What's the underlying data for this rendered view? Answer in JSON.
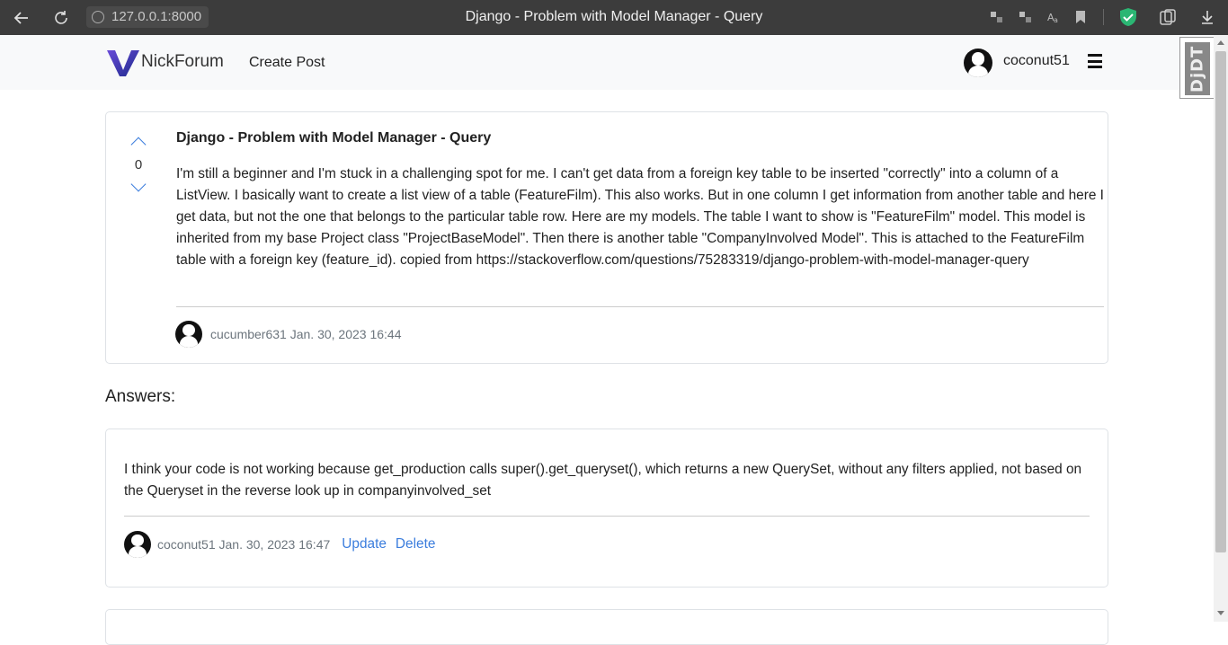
{
  "browser": {
    "url": "127.0.0.1:8000",
    "tab_title": "Django - Problem with Model Manager - Query"
  },
  "navbar": {
    "brand": "NickForum",
    "create_post": "Create Post",
    "username": "coconut51",
    "debug_toolbar": "DjDT"
  },
  "question": {
    "title": "Django - Problem with Model Manager - Query",
    "votes": "0",
    "body": "I'm still a beginner and I'm stuck in a challenging spot for me. I can't get data from a foreign key table to be inserted \"correctly\" into a column of a ListView. I basically want to create a list view of a table (FeatureFilm). This also works. But in one column I get information from another table and here I get data, but not the one that belongs to the particular table row. Here are my models. The table I want to show is \"FeatureFilm\" model. This model is inherited from my base Project class \"ProjectBaseModel\". Then there is another table \"CompanyInvolved Model\". This is attached to the FeatureFilm table with a foreign key (feature_id). copied from https://stackoverflow.com/questions/75283319/django-problem-with-model-manager-query",
    "author": "cucumber631",
    "date": "Jan. 30, 2023 16:44"
  },
  "answers_heading": "Answers:",
  "answers": [
    {
      "body": "I think your code is not working because get_production calls super().get_queryset(), which returns a new QuerySet, without any filters applied, not based on the Queryset in the reverse look up in companyinvolved_set",
      "author": "coconut51",
      "date": "Jan. 30, 2023 16:47",
      "update_label": "Update",
      "delete_label": "Delete"
    }
  ],
  "colors": {
    "link": "#3b7ddd",
    "navbar_bg": "#f8f9fa",
    "chrome_bg": "#3c3c3c"
  }
}
